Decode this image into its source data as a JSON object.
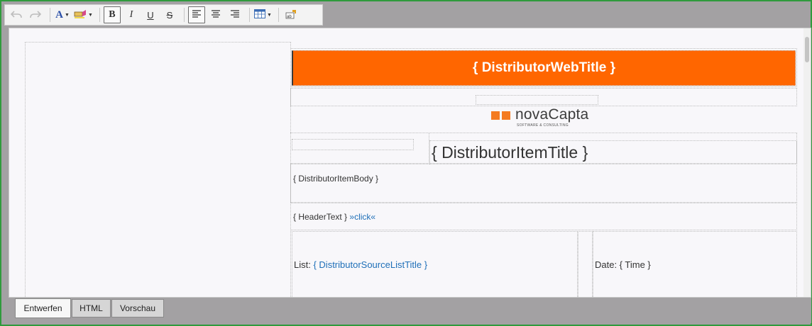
{
  "toolbar": {
    "undo_icon": "undo-icon",
    "redo_icon": "redo-icon",
    "font_color_glyph": "A",
    "bold_glyph": "B",
    "italic_glyph": "I",
    "underline_glyph": "U",
    "strike_glyph": "S",
    "caret": "▼"
  },
  "colors": {
    "frame_border": "#2f9a3c",
    "title_band": "#ff6600",
    "link": "#1e6fb8",
    "logo_orange": "#f47b20"
  },
  "content": {
    "web_title": "{ DistributorWebTitle }",
    "logo_name": "novaCapta",
    "logo_tagline": "SOFTWARE & CONSULTING",
    "item_title": "{ DistributorItemTitle }",
    "item_body": "{ DistributorItemBody }",
    "header_text": "{ HeaderText }",
    "click_link": "»click«",
    "list_label": "List:",
    "list_value": "{ DistributorSourceListTitle }",
    "date_text": "Date: { Time }"
  },
  "tabs": [
    {
      "label": "Entwerfen",
      "active": true
    },
    {
      "label": "HTML",
      "active": false
    },
    {
      "label": "Vorschau",
      "active": false
    }
  ]
}
